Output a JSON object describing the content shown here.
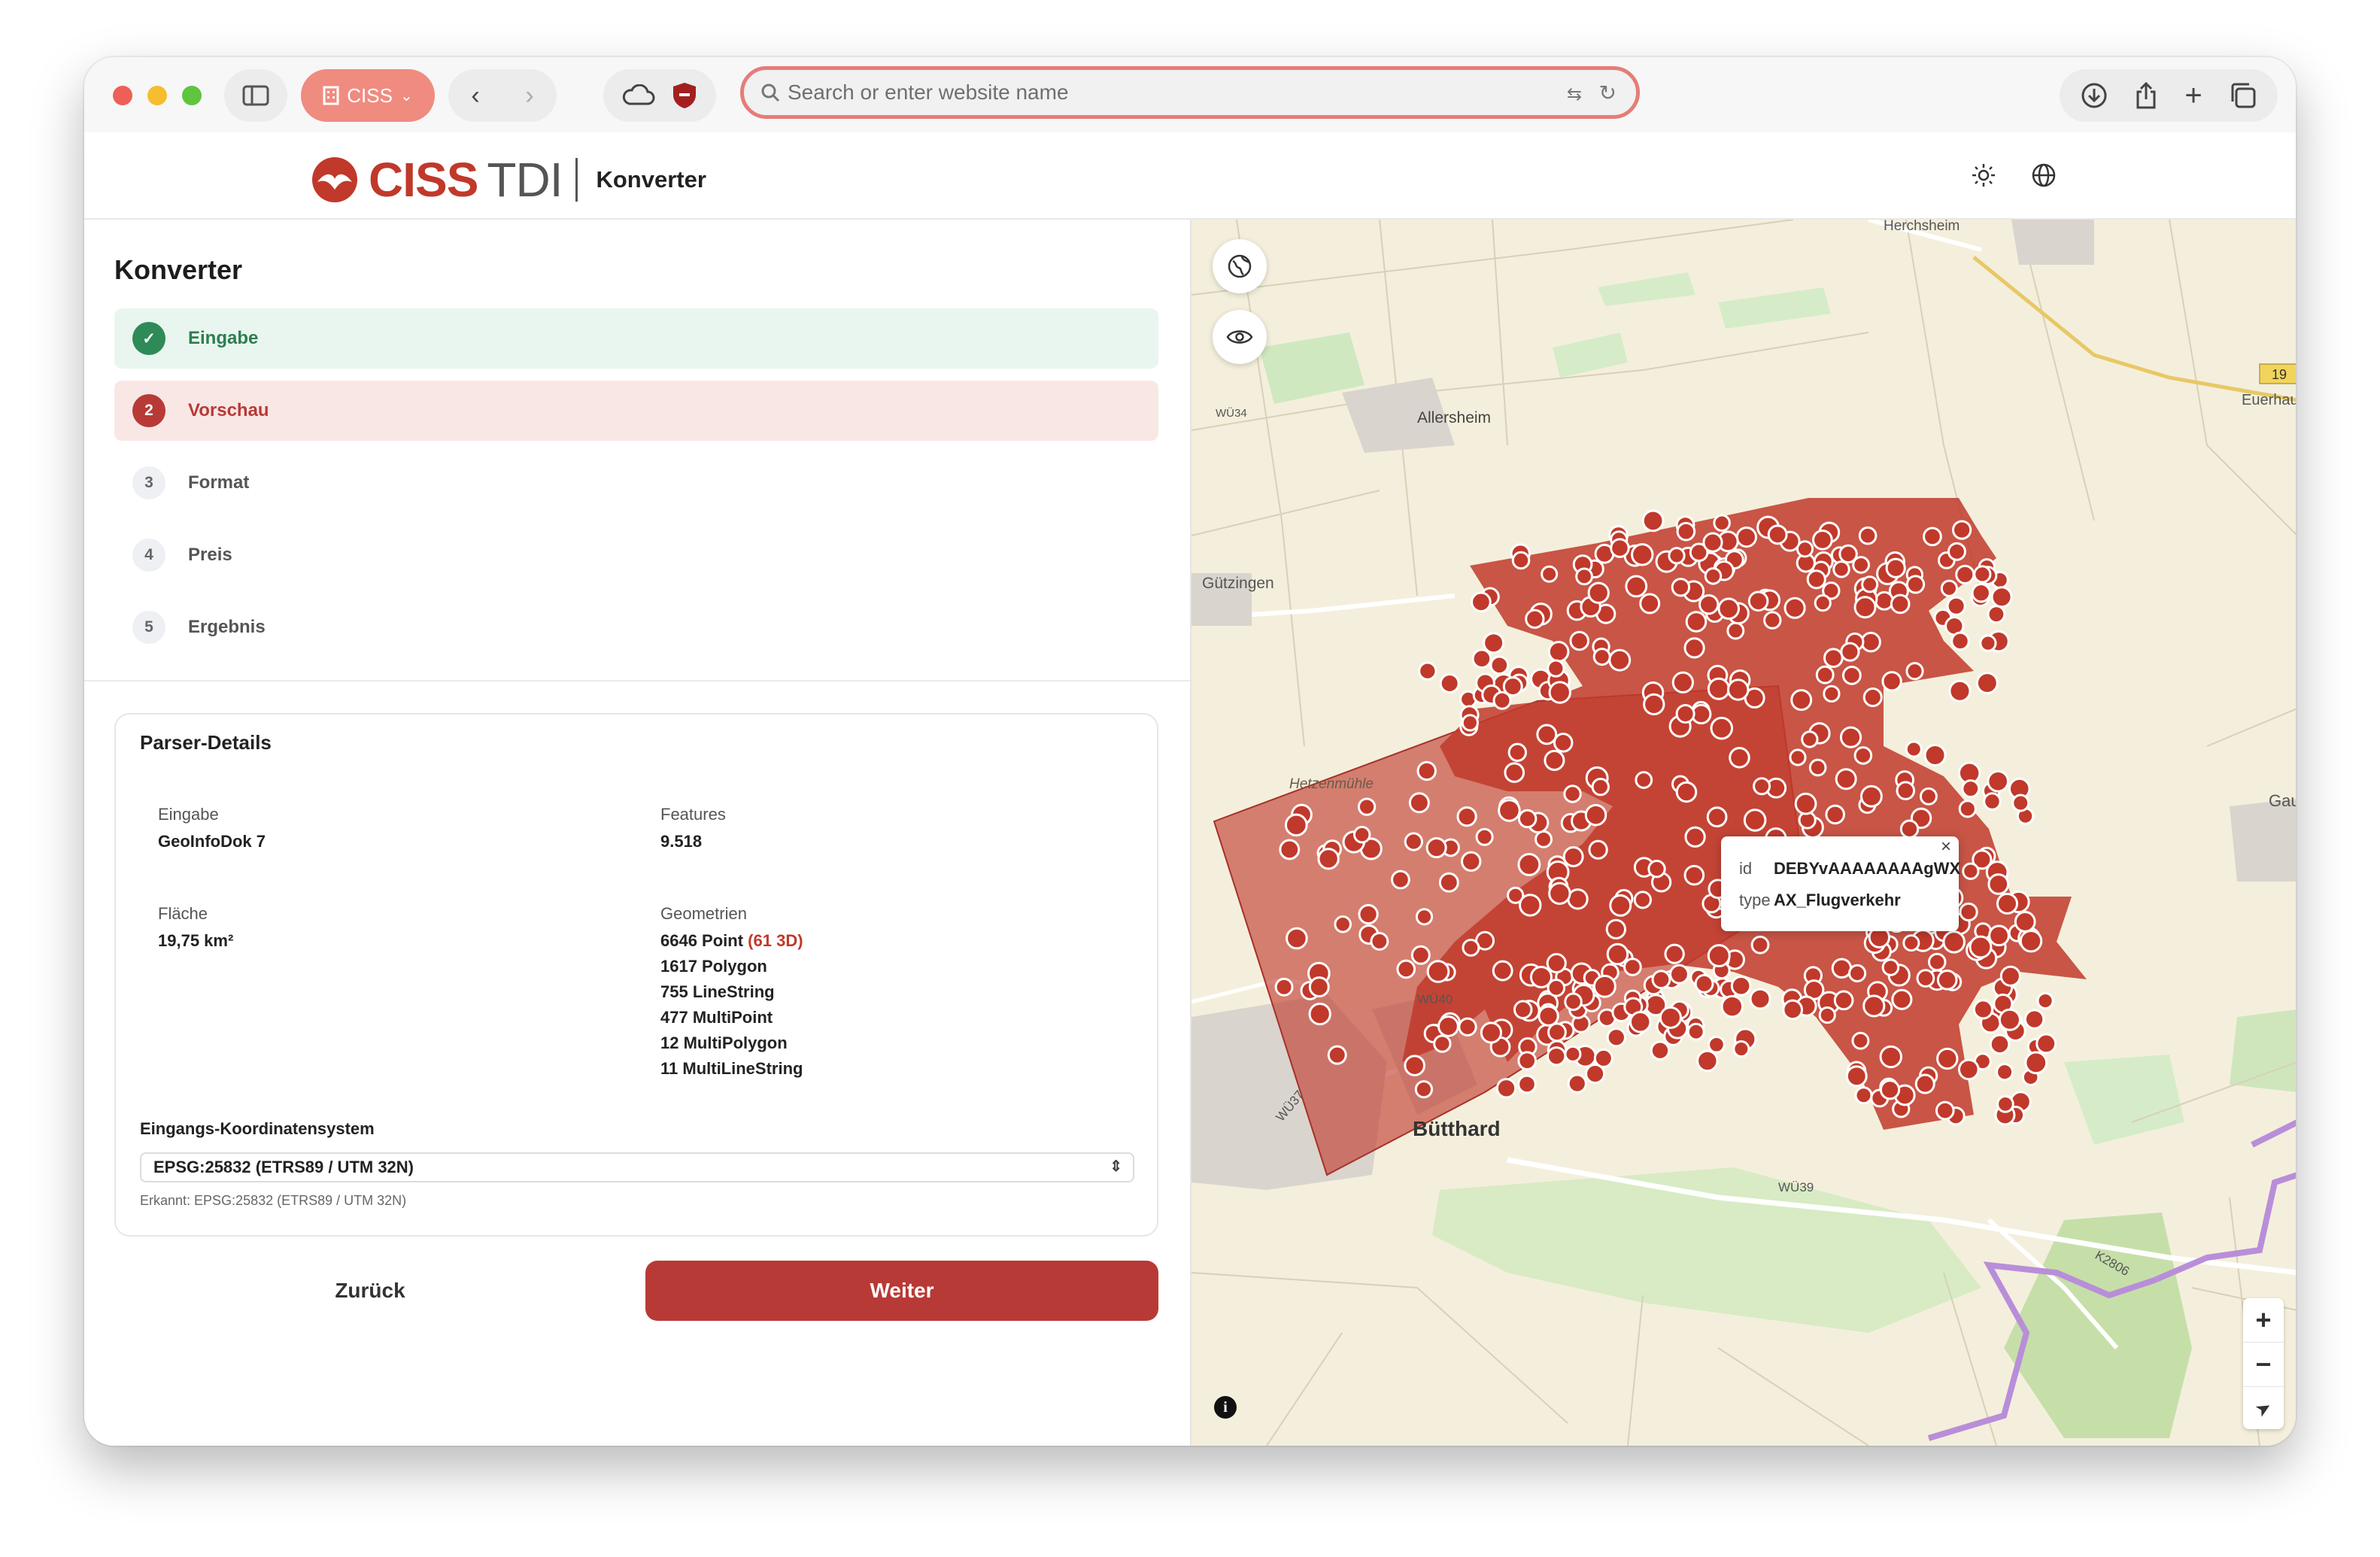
{
  "browser": {
    "tab_label": "CISS",
    "address_placeholder": "Search or enter website name"
  },
  "app": {
    "brand_left": "CISS",
    "brand_right": "TDI",
    "header_title": "Konverter"
  },
  "wizard": {
    "title": "Konverter",
    "steps": [
      {
        "num": "✓",
        "label": "Eingabe",
        "state": "done"
      },
      {
        "num": "2",
        "label": "Vorschau",
        "state": "active"
      },
      {
        "num": "3",
        "label": "Format",
        "state": "pending"
      },
      {
        "num": "4",
        "label": "Preis",
        "state": "pending"
      },
      {
        "num": "5",
        "label": "Ergebnis",
        "state": "pending"
      }
    ]
  },
  "parser": {
    "title": "Parser-Details",
    "input_label": "Eingabe",
    "input_value": "GeoInfoDok 7",
    "features_label": "Features",
    "features_value": "9.518",
    "area_label": "Fläche",
    "area_value": "19,75 km²",
    "geometries_label": "Geometrien",
    "geometries": [
      {
        "text": "6646 Point",
        "extra": "(61 3D)"
      },
      {
        "text": "1617 Polygon",
        "extra": ""
      },
      {
        "text": "755 LineString",
        "extra": ""
      },
      {
        "text": "477 MultiPoint",
        "extra": ""
      },
      {
        "text": "12 MultiPolygon",
        "extra": ""
      },
      {
        "text": "11 MultiLineString",
        "extra": ""
      }
    ],
    "crs_label": "Eingangs-Koordinatensystem",
    "crs_value": "EPSG:25832 (ETRS89 / UTM 32N)",
    "crs_detected": "Erkannt: EPSG:25832 (ETRS89 / UTM 32N)"
  },
  "actions": {
    "back": "Zurück",
    "next": "Weiter"
  },
  "map": {
    "popup": {
      "id_label": "id",
      "id_value": "DEBYvAAAAAAAAgWX",
      "type_label": "type",
      "type_value": "AX_Flugverkehr",
      "close": "×"
    },
    "places": {
      "herchsheim": "Herchsheim",
      "allersheim": "Allersheim",
      "guetzingen": "Gützingen",
      "huetzenmuehle": "Hetzenmühle",
      "buetthard": "Bütthard",
      "euerhausen": "Euerhaus",
      "gau": "Gau",
      "road_19": "19",
      "road_wu39": "WÜ39",
      "road_wu40": "WÜ40",
      "road_wu37": "WÜ37",
      "road_wu34": "WÜ34",
      "road_k2806": "K2806"
    },
    "zoom_in": "+",
    "zoom_out": "−",
    "compass": "➤",
    "info": "i"
  },
  "colors": {
    "accent": "#b73a36",
    "done_bg": "#e9f6ef",
    "done_fg": "#2e7d4f",
    "active_bg": "#f9e7e5",
    "feature_fill": "#c0392b"
  }
}
